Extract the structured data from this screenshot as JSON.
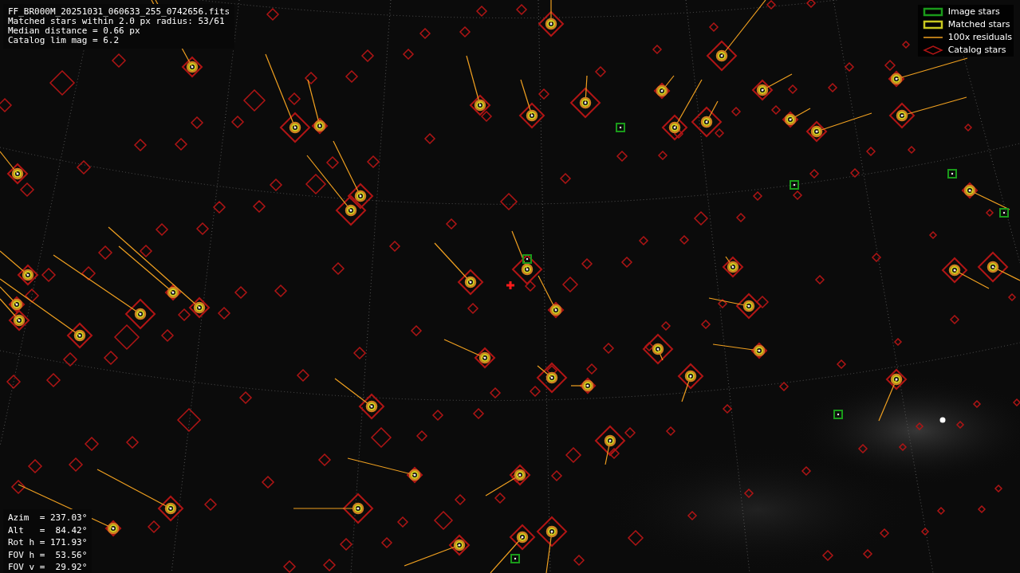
{
  "header": {
    "lines": [
      "FF_BR000M_20251031_060633_255_0742656.fits",
      "Matched stars within 2.0 px radius: 53/61",
      "Median distance = 0.66 px",
      "Catalog lim mag = 6.2"
    ]
  },
  "legend": [
    {
      "kind": "image",
      "label": "Image stars"
    },
    {
      "kind": "matched",
      "label": "Matched stars"
    },
    {
      "kind": "residual",
      "label": "100x residuals"
    },
    {
      "kind": "catalog",
      "label": "Catalog stars"
    }
  ],
  "pointing": {
    "lines": [
      "Azim  = 237.03°",
      "Alt   =  84.42°",
      "Rot h = 171.93°",
      "FOV h =  53.56°",
      "FOV v =  29.92°"
    ]
  }
}
